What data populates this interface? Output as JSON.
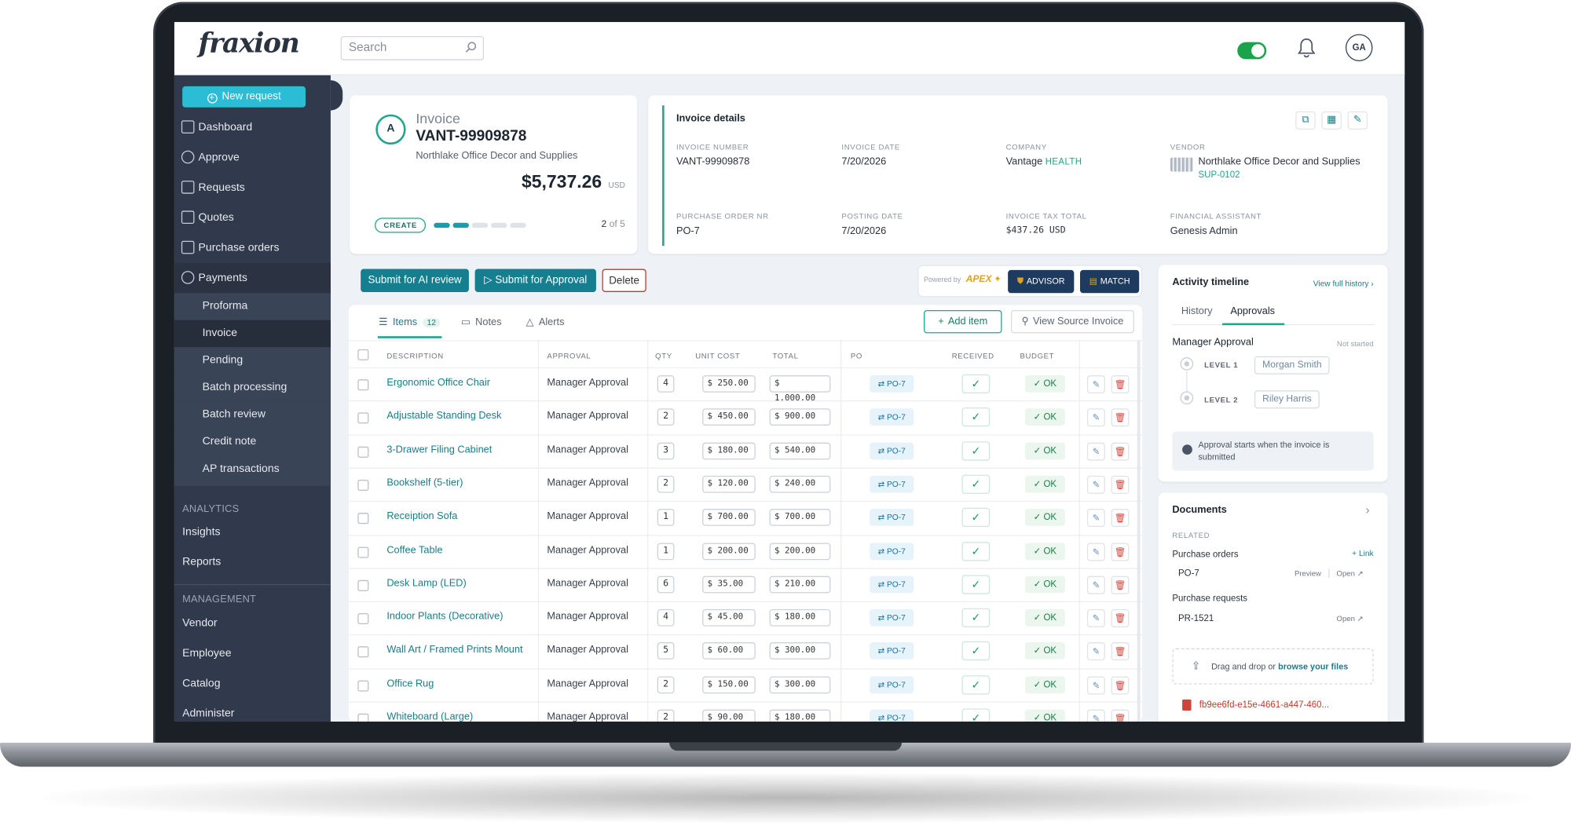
{
  "app": {
    "logo": "fraxion",
    "search_placeholder": "Search",
    "avatar_initials": "GA"
  },
  "sidebar": {
    "new_request": "New request",
    "items": [
      "Dashboard",
      "Approve",
      "Requests",
      "Quotes",
      "Purchase orders",
      "Payments"
    ],
    "payments_sub": [
      "Proforma",
      "Invoice",
      "Pending",
      "Batch processing",
      "Batch review",
      "Credit note",
      "AP transactions"
    ],
    "analytics_head": "ANALYTICS",
    "analytics": [
      "Insights",
      "Reports"
    ],
    "management_head": "MANAGEMENT",
    "management": [
      "Vendor",
      "Employee",
      "Catalog",
      "Administer"
    ]
  },
  "invoice": {
    "badge": "A",
    "title": "Invoice",
    "number": "VANT-99909878",
    "vendor": "Northlake Office Decor and Supplies",
    "amount": "$5,737.26",
    "currency": "USD",
    "stage": "CREATE",
    "step": "2",
    "step_of": "of 5",
    "progress_steps_done": 2,
    "progress_steps_total": 5
  },
  "details": {
    "heading": "Invoice details",
    "invoice_number_label": "INVOICE NUMBER",
    "invoice_number": "VANT-99909878",
    "invoice_date_label": "INVOICE DATE",
    "invoice_date": "7/20/2026",
    "company_label": "COMPANY",
    "company": "Vantage",
    "company_tag": "HEALTH",
    "vendor_label": "VENDOR",
    "vendor": "Northlake Office Decor and Supplies",
    "vendor_code": "SUP-0102",
    "po_label": "PURCHASE ORDER NR",
    "po": "PO-7",
    "posting_date_label": "POSTING DATE",
    "posting_date": "7/20/2026",
    "tax_label": "INVOICE TAX TOTAL",
    "tax": "$437.26 USD",
    "fa_label": "FINANCIAL ASSISTANT",
    "fa": "Genesis Admin"
  },
  "actions": {
    "ai_review": "Submit for AI review",
    "approval": "Submit for Approval",
    "delete": "Delete",
    "powered_by": "Powered by",
    "apex": "APEX",
    "advisor": "ADVISOR",
    "match": "MATCH"
  },
  "table": {
    "tabs": {
      "items": "Items",
      "items_count": "12",
      "notes": "Notes",
      "alerts": "Alerts"
    },
    "add_item": "Add item",
    "view_source": "View Source Invoice",
    "headers": [
      "DESCRIPTION",
      "APPROVAL",
      "QTY",
      "UNIT COST",
      "TOTAL",
      "PO",
      "RECEIVED",
      "BUDGET"
    ],
    "rows": [
      {
        "desc": "Ergonomic Office Chair",
        "approval": "Manager Approval",
        "qty": "4",
        "unit": "$ 250.00",
        "total": "$ 1,000.00",
        "po": "PO-7",
        "budget": "OK"
      },
      {
        "desc": "Adjustable Standing Desk",
        "approval": "Manager Approval",
        "qty": "2",
        "unit": "$ 450.00",
        "total": "$ 900.00",
        "po": "PO-7",
        "budget": "OK"
      },
      {
        "desc": "3-Drawer Filing Cabinet",
        "approval": "Manager Approval",
        "qty": "3",
        "unit": "$ 180.00",
        "total": "$ 540.00",
        "po": "PO-7",
        "budget": "OK"
      },
      {
        "desc": "Bookshelf (5-tier)",
        "approval": "Manager Approval",
        "qty": "2",
        "unit": "$ 120.00",
        "total": "$ 240.00",
        "po": "PO-7",
        "budget": "OK"
      },
      {
        "desc": "Receiption Sofa",
        "approval": "Manager Approval",
        "qty": "1",
        "unit": "$ 700.00",
        "total": "$ 700.00",
        "po": "PO-7",
        "budget": "OK"
      },
      {
        "desc": "Coffee Table",
        "approval": "Manager Approval",
        "qty": "1",
        "unit": "$ 200.00",
        "total": "$ 200.00",
        "po": "PO-7",
        "budget": "OK"
      },
      {
        "desc": "Desk Lamp (LED)",
        "approval": "Manager Approval",
        "qty": "6",
        "unit": "$ 35.00",
        "total": "$ 210.00",
        "po": "PO-7",
        "budget": "OK"
      },
      {
        "desc": "Indoor Plants (Decorative)",
        "approval": "Manager Approval",
        "qty": "4",
        "unit": "$ 45.00",
        "total": "$ 180.00",
        "po": "PO-7",
        "budget": "OK"
      },
      {
        "desc": "Wall Art / Framed Prints Mount",
        "approval": "Manager Approval",
        "qty": "5",
        "unit": "$ 60.00",
        "total": "$ 300.00",
        "po": "PO-7",
        "budget": "OK"
      },
      {
        "desc": "Office Rug",
        "approval": "Manager Approval",
        "qty": "2",
        "unit": "$ 150.00",
        "total": "$ 300.00",
        "po": "PO-7",
        "budget": "OK"
      },
      {
        "desc": "Whiteboard (Large)",
        "approval": "Manager Approval",
        "qty": "2",
        "unit": "$ 90.00",
        "total": "$ 180.00",
        "po": "PO-7",
        "budget": "OK"
      }
    ]
  },
  "timeline": {
    "heading": "Activity timeline",
    "view_full": "View full history",
    "tab_history": "History",
    "tab_approvals": "Approvals",
    "group": "Manager Approval",
    "status": "Not started",
    "level1": "LEVEL 1",
    "level1_name": "Morgan Smith",
    "level2": "LEVEL 2",
    "level2_name": "Riley Harris",
    "note": "Approval starts when the invoice is submitted"
  },
  "documents": {
    "heading": "Documents",
    "related": "RELATED",
    "po_head": "Purchase orders",
    "link": "Link",
    "po_item": "PO-7",
    "preview": "Preview",
    "open": "Open",
    "pr_head": "Purchase requests",
    "pr_item": "PR-1521",
    "drop_text": "Drag and drop or",
    "browse": "browse your files",
    "file": "fb9ee6fd-e15e-4661-a447-460..."
  },
  "colors": {
    "accent": "#1fa58a",
    "sidebar": "#313a4c",
    "primary_button": "#157f8f",
    "new_request": "#2bbcd6"
  }
}
